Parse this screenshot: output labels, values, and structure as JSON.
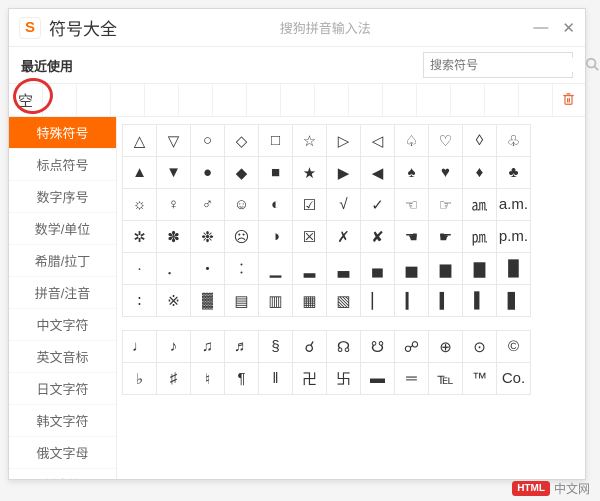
{
  "titlebar": {
    "logo_text": "S",
    "title": "符号大全",
    "subtitle": "搜狗拼音输入法"
  },
  "toolbar": {
    "recent_label": "最近使用",
    "search_placeholder": "搜索符号"
  },
  "recent": {
    "items": [
      "空"
    ]
  },
  "categories": [
    "特殊符号",
    "标点符号",
    "数字序号",
    "数学/单位",
    "希腊/拉丁",
    "拼音/注音",
    "中文字符",
    "英文音标",
    "日文字符",
    "韩文字符",
    "俄文字母",
    "制表符"
  ],
  "active_category_index": 0,
  "symbol_rows_top": [
    [
      "△",
      "▽",
      "○",
      "◇",
      "□",
      "☆",
      "▷",
      "◁",
      "♤",
      "♡",
      "◊",
      "♧"
    ],
    [
      "▲",
      "▼",
      "●",
      "◆",
      "■",
      "★",
      "▶",
      "◀",
      "♠",
      "♥",
      "♦",
      "♣"
    ],
    [
      "☼",
      "♀",
      "♂",
      "☺",
      "◐",
      "☑",
      "√",
      "✓",
      "☜",
      "☞",
      "㏂",
      "a.m."
    ],
    [
      "✲",
      "✽",
      "❉",
      "☹",
      "◑",
      "☒",
      "✗",
      "✘",
      "☚",
      "☛",
      "㏘",
      "p.m."
    ],
    [
      "·",
      "．",
      "・",
      "︰",
      "▁",
      "▂",
      "▃",
      "▄",
      "▅",
      "▆",
      "▇",
      "█"
    ],
    [
      "∶",
      "※",
      "▓",
      "▤",
      "▥",
      "▦",
      "▧",
      "▏",
      "▎",
      "▍",
      "▌",
      "▋"
    ]
  ],
  "symbol_rows_bottom": [
    [
      "♩",
      "♪",
      "♫",
      "♬",
      "§",
      "☌",
      "☊",
      "☋",
      "☍",
      "⊕",
      "⊙",
      "©"
    ],
    [
      "♭",
      "♯",
      "♮",
      "¶",
      "‖",
      "卍",
      "卐",
      "▬",
      "═",
      "℡",
      "™",
      "Co."
    ]
  ],
  "brand": {
    "badge": "HTML",
    "text": "中文网"
  }
}
